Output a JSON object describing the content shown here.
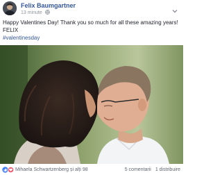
{
  "post": {
    "author": "Felix Baumgartner",
    "timestamp": "13 minute",
    "privacy_icon": "globe-icon",
    "text_lines": [
      "Happy Valentines Day! Thank you so much for all these amazing years!",
      "FELIX"
    ],
    "hashtag": "#valentinesday",
    "reactions_text": "Mihaela Schwartzenberg și alți 98",
    "comments_count": "5 comentarii",
    "shares_count": "1 distribuire"
  },
  "colors": {
    "link": "#365899",
    "meta": "#90949c",
    "like": "#4080ff",
    "love": "#f25268"
  }
}
